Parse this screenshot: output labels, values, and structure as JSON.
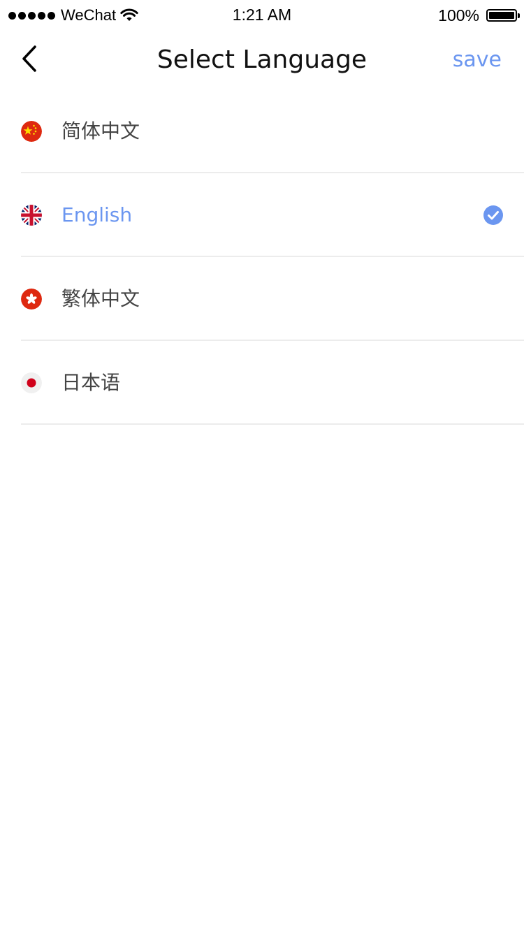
{
  "status_bar": {
    "carrier": "WeChat",
    "time": "1:21 AM",
    "battery_percent": "100%",
    "signal_icon": "signal-dots-icon",
    "wifi_icon": "wifi-icon",
    "battery_icon": "battery-icon",
    "battery_level": 1.0
  },
  "nav": {
    "back_icon": "chevron-left-icon",
    "title": "Select Language",
    "save_label": "save"
  },
  "languages": [
    {
      "label": "简体中文",
      "flag": "china-flag-icon",
      "selected": false
    },
    {
      "label": "English",
      "flag": "uk-flag-icon",
      "selected": true
    },
    {
      "label": "繁体中文",
      "flag": "hong-kong-flag-icon",
      "selected": false
    },
    {
      "label": "日本语",
      "flag": "japan-flag-icon",
      "selected": false
    }
  ],
  "colors": {
    "accent": "#6b96f0",
    "text_primary": "#111111",
    "text_secondary": "#444444",
    "divider": "#ececec"
  }
}
